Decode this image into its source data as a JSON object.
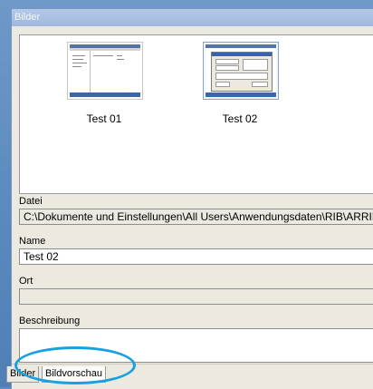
{
  "window": {
    "title": "Bilder"
  },
  "thumbnails": [
    {
      "caption": "Test 01"
    },
    {
      "caption": "Test 02"
    }
  ],
  "fields": {
    "datei": {
      "label": "Datei",
      "value": "C:\\Dokumente und Einstellungen\\All Users\\Anwendungsdaten\\RIB\\ARRIBAp"
    },
    "name": {
      "label": "Name",
      "value": "Test 02"
    },
    "ort": {
      "label": "Ort",
      "value": ""
    },
    "beschreibung": {
      "label": "Beschreibung",
      "value": ""
    }
  },
  "tabs": [
    {
      "label": "Bilder",
      "active": false
    },
    {
      "label": "Bildvorschau",
      "active": true
    }
  ],
  "colors": {
    "highlight": "#19a0e0",
    "titlebar": "#9fb8dd"
  }
}
